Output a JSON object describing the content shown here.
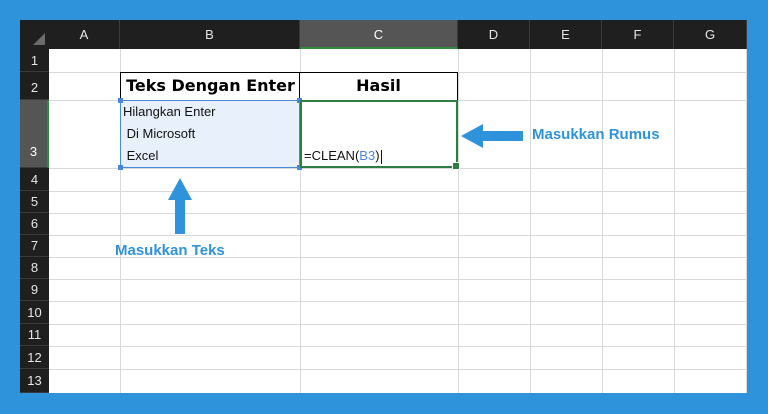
{
  "columns": [
    "A",
    "B",
    "C",
    "D",
    "E",
    "F",
    "G"
  ],
  "rows": [
    "1",
    "2",
    "3",
    "4",
    "5",
    "6",
    "7",
    "8",
    "9",
    "10",
    "11",
    "12",
    "13"
  ],
  "cells": {
    "B2": "Teks Dengan Enter",
    "C2": "Hasil",
    "B3_lines": [
      "Hilangkan Enter",
      " Di Microsoft",
      " Excel"
    ],
    "C3_formula_prefix": "=CLEAN(",
    "C3_formula_ref": "B3",
    "C3_formula_suffix": ")"
  },
  "annotations": {
    "rumus_label": "Masukkan Rumus",
    "teks_label": "Masukkan Teks"
  },
  "colors": {
    "background": "#2f93dc",
    "header_dark": "#1f1f1f",
    "selection_green": "#2e7d43",
    "reference_blue": "#4a86d9",
    "annotation_blue": "#2f93dc"
  },
  "icons": [
    "corner-select-icon",
    "arrow-left-icon",
    "arrow-up-icon"
  ]
}
